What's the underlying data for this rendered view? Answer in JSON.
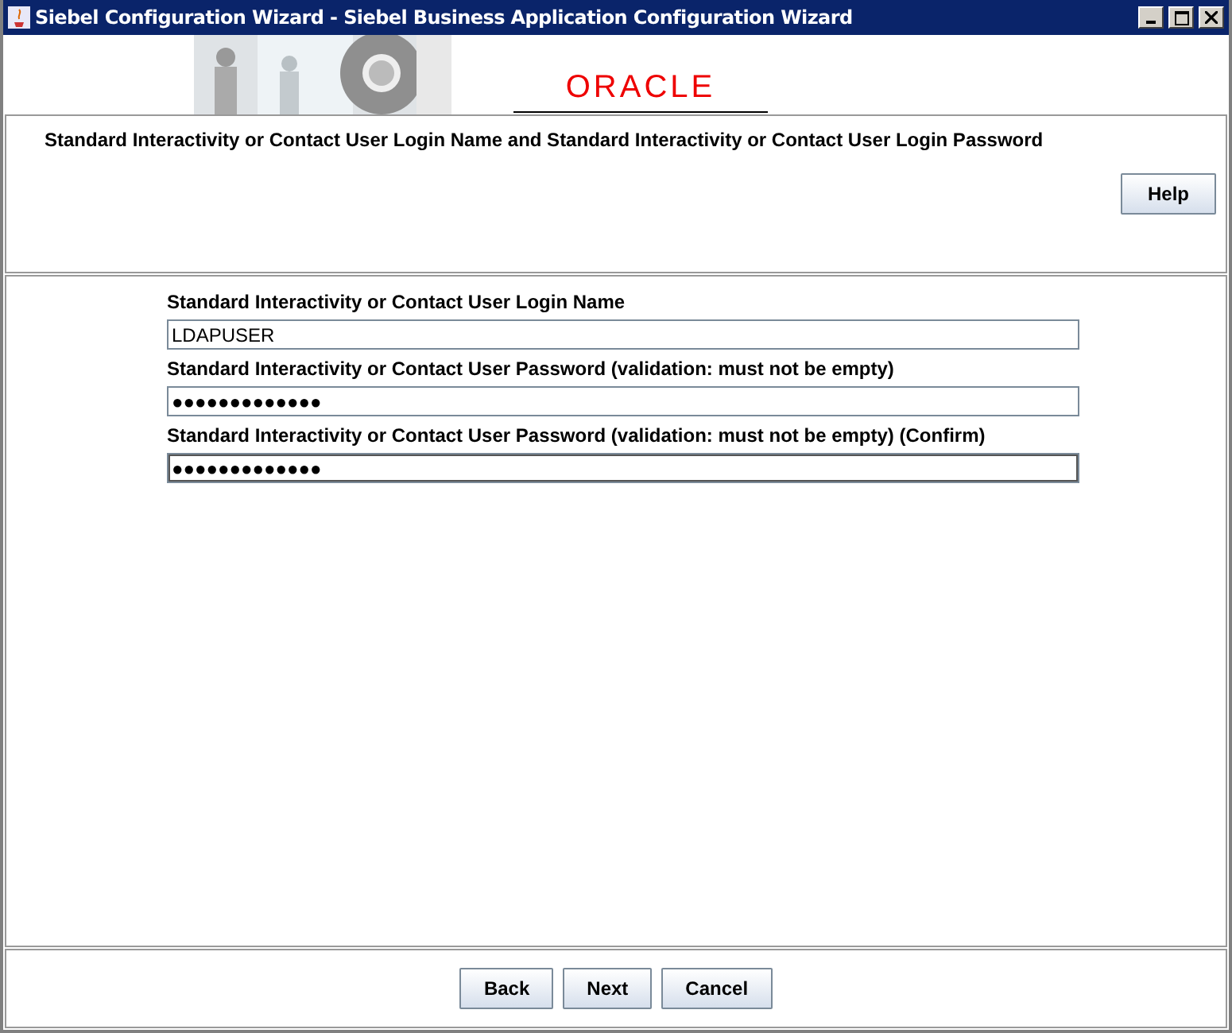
{
  "window": {
    "title": "Siebel Configuration Wizard - Siebel Business Application Configuration Wizard"
  },
  "banner": {
    "logo": "ORACLE"
  },
  "header": {
    "description": "Standard Interactivity or Contact User Login Name and Standard Interactivity or Contact User Login Password",
    "help_button": "Help"
  },
  "fields": [
    {
      "label": "Standard Interactivity or Contact User Login Name",
      "value": "LDAPUSER",
      "focused": false
    },
    {
      "label": "Standard Interactivity or Contact User Password (validation: must not be empty)",
      "value": "●●●●●●●●●●●●●",
      "focused": false
    },
    {
      "label": "Standard Interactivity or Contact User Password (validation: must not be empty) (Confirm)",
      "value": "●●●●●●●●●●●●●",
      "focused": true
    }
  ],
  "buttons": [
    "Back",
    "Next",
    "Cancel"
  ]
}
